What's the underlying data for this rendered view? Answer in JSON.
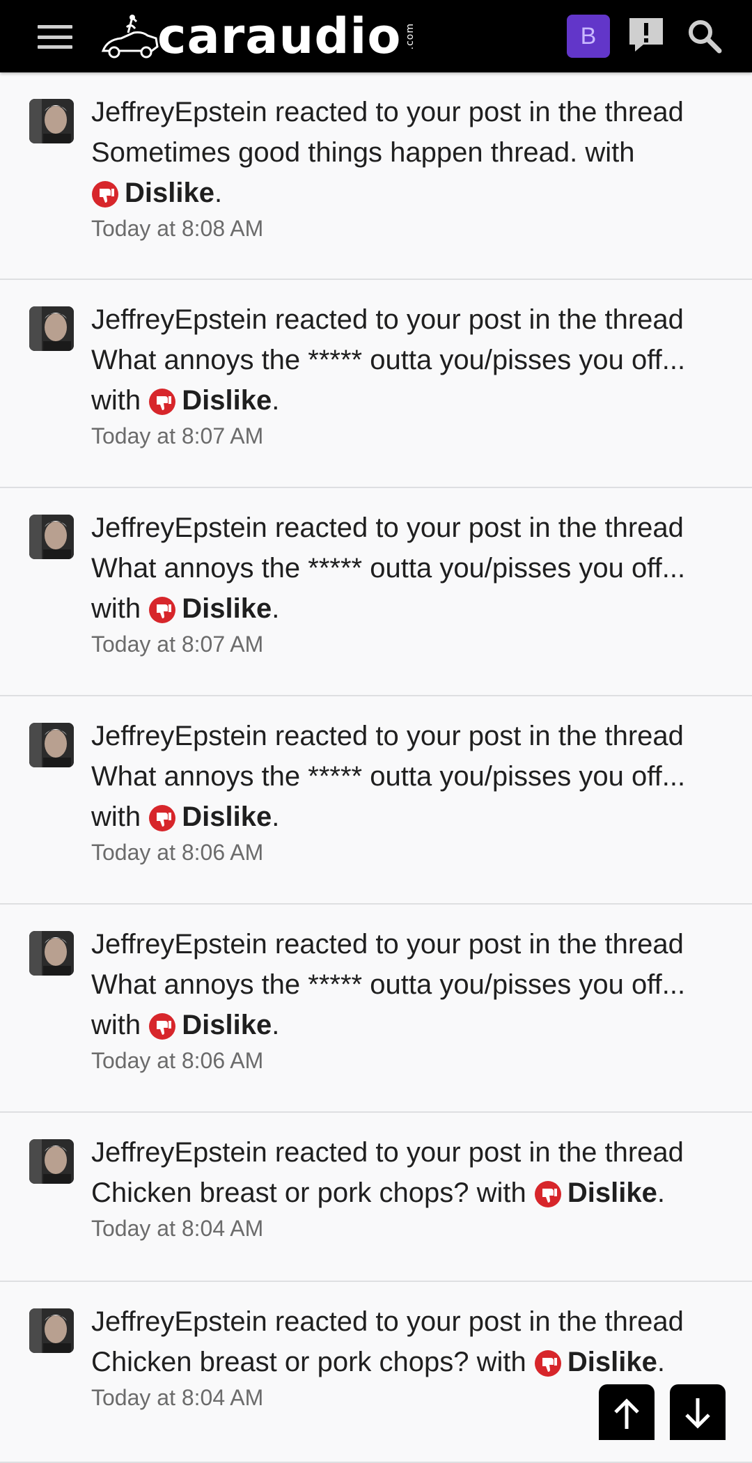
{
  "header": {
    "logo_text": "caraudio",
    "logo_suffix": ".com",
    "user_initial": "B",
    "icons": [
      "menu-icon",
      "alert-icon",
      "search-icon"
    ]
  },
  "notifications": [
    {
      "user": "JeffreyEpstein",
      "action": "reacted to your post in the thread",
      "thread": "Sometimes good things happen thread.",
      "with_text": "with",
      "reaction": "Dislike",
      "end": ".",
      "time": "Today at 8:08 AM"
    },
    {
      "user": "JeffreyEpstein",
      "action": "reacted to your post in the thread",
      "thread": "What annoys the ***** outta you/pisses you off...",
      "with_text": "with",
      "reaction": "Dislike",
      "end": ".",
      "time": "Today at 8:07 AM"
    },
    {
      "user": "JeffreyEpstein",
      "action": "reacted to your post in the thread",
      "thread": "What annoys the ***** outta you/pisses you off...",
      "with_text": "with",
      "reaction": "Dislike",
      "end": ".",
      "time": "Today at 8:07 AM"
    },
    {
      "user": "JeffreyEpstein",
      "action": "reacted to your post in the thread",
      "thread": "What annoys the ***** outta you/pisses you off...",
      "with_text": "with",
      "reaction": "Dislike",
      "end": ".",
      "time": "Today at 8:06 AM"
    },
    {
      "user": "JeffreyEpstein",
      "action": "reacted to your post in the thread",
      "thread": "What annoys the ***** outta you/pisses you off...",
      "with_text": "with",
      "reaction": "Dislike",
      "end": ".",
      "time": "Today at 8:06 AM"
    },
    {
      "user": "JeffreyEpstein",
      "action": "reacted to your post in the thread",
      "thread": "Chicken breast or pork chops?",
      "with_text": "with",
      "reaction": "Dislike",
      "end": ".",
      "time": "Today at 8:04 AM"
    },
    {
      "user": "JeffreyEpstein",
      "action": "reacted to your post in the thread",
      "thread": "Chicken breast or pork chops?",
      "with_text": "with",
      "reaction": "Dislike",
      "end": ".",
      "time": "Today at 8:04 AM"
    }
  ],
  "scroll_buttons": [
    "arrow-up-icon",
    "arrow-down-icon"
  ],
  "colors": {
    "header_bg": "#000000",
    "avatar_bg": "#6236c9",
    "dislike_red": "#d7262b",
    "time_text": "#6b6b6b"
  }
}
